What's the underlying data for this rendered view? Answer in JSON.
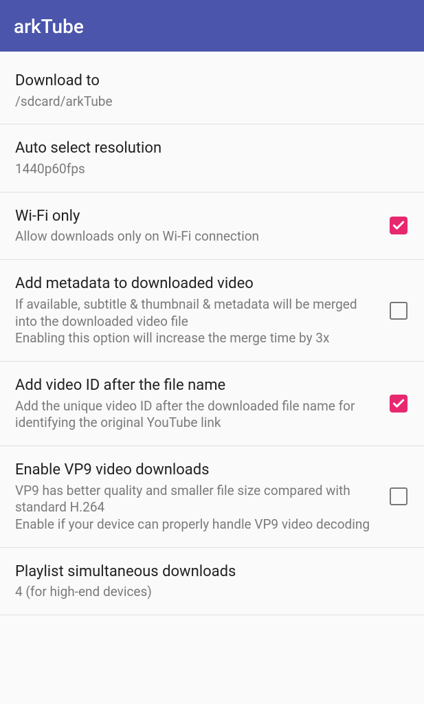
{
  "appBar": {
    "title": "arkTube"
  },
  "settings": [
    {
      "title": "Download to",
      "subtitle": "/sdcard/arkTube",
      "hasCheckbox": false
    },
    {
      "title": "Auto select resolution",
      "subtitle": "1440p60fps",
      "hasCheckbox": false
    },
    {
      "title": "Wi-Fi only",
      "subtitle": "Allow downloads only on Wi-Fi connection",
      "hasCheckbox": true,
      "checked": true
    },
    {
      "title": "Add metadata to downloaded video",
      "subtitle": "If available, subtitle & thumbnail & metadata will be merged into the downloaded video file\nEnabling this option will increase the merge time by 3x",
      "hasCheckbox": true,
      "checked": false
    },
    {
      "title": "Add video ID after the file name",
      "subtitle": "Add the unique video ID after the downloaded file name for identifying the original YouTube link",
      "hasCheckbox": true,
      "checked": true
    },
    {
      "title": "Enable VP9 video downloads",
      "subtitle": "VP9 has better quality and smaller file size compared with standard H.264\nEnable if your device can properly handle VP9 video decoding",
      "hasCheckbox": true,
      "checked": false
    },
    {
      "title": "Playlist simultaneous downloads",
      "subtitle": "4 (for high-end devices)",
      "hasCheckbox": false
    }
  ]
}
